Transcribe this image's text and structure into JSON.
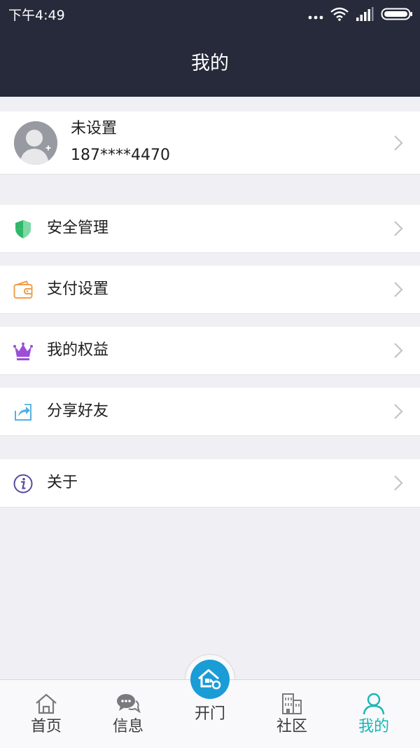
{
  "status_bar": {
    "time": "下午4:49",
    "icons": [
      "more-dots-icon",
      "wifi-icon",
      "signal-icon",
      "battery-icon"
    ]
  },
  "header": {
    "title": "我的"
  },
  "profile": {
    "name": "未设置",
    "phone": "187****4470",
    "avatar_icon": "avatar-placeholder-icon"
  },
  "menu": {
    "items": [
      {
        "label": "安全管理",
        "icon": "shield-icon",
        "color": "#2fb86a"
      },
      {
        "label": "支付设置",
        "icon": "wallet-icon",
        "color": "#f0a04b"
      },
      {
        "label": "我的权益",
        "icon": "crown-icon",
        "color": "#9b4fd6"
      },
      {
        "label": "分享好友",
        "icon": "share-icon",
        "color": "#4fb0e0"
      },
      {
        "label": "关于",
        "icon": "info-icon",
        "color": "#5b4a9e"
      }
    ]
  },
  "tab_bar": {
    "tabs": [
      {
        "label": "首页",
        "icon": "home-icon",
        "active": false
      },
      {
        "label": "信息",
        "icon": "message-icon",
        "active": false
      },
      {
        "label": "开门",
        "icon": "door-key-icon",
        "active": false
      },
      {
        "label": "社区",
        "icon": "building-icon",
        "active": false
      },
      {
        "label": "我的",
        "icon": "user-icon",
        "active": true
      }
    ]
  },
  "colors": {
    "header_bg": "#262a3b",
    "page_bg": "#efeff4",
    "active_tab": "#17b7b5",
    "door_button": "#1a9cd6"
  }
}
